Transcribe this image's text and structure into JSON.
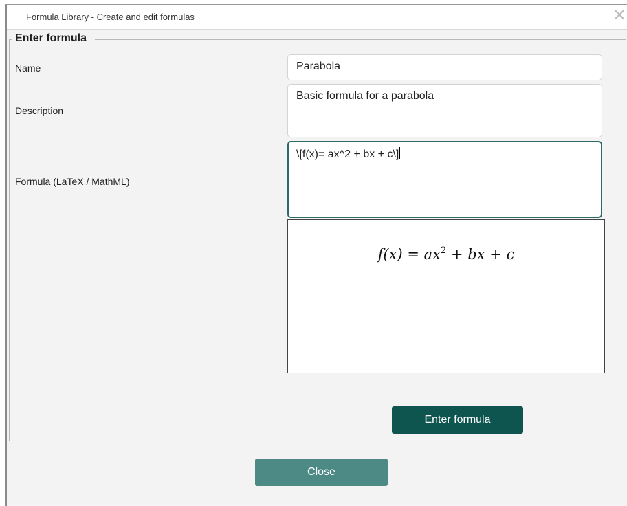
{
  "window": {
    "title": "Formula Library - Create and edit formulas",
    "close_glyph": "✕"
  },
  "form": {
    "legend": "Enter formula",
    "name_label": "Name",
    "name_value": "Parabola",
    "description_label": "Description",
    "description_value": "Basic formula for a parabola",
    "formula_label": "Formula (LaTeX / MathML)",
    "formula_value": "\\[f(x)= ax^2 + bx + c\\]"
  },
  "preview": {
    "lhs": "f(x)",
    "eq": "=",
    "a": "ax",
    "exp": "2",
    "plus1": "+",
    "b": "bx",
    "plus2": "+",
    "c": "c"
  },
  "buttons": {
    "enter_label": "Enter formula",
    "close_label": "Close"
  },
  "colors": {
    "primary_button": "#0e5550",
    "secondary_button": "#4d8a85",
    "focus_border": "#2e6a66"
  }
}
